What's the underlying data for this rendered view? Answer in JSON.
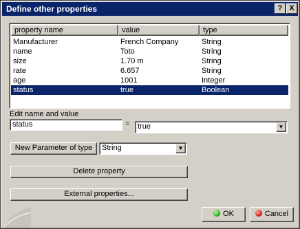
{
  "window": {
    "title": "Define other properties",
    "help_label": "?",
    "close_label": "X"
  },
  "list": {
    "columns": [
      "property name",
      "value",
      "type"
    ],
    "rows": [
      {
        "name": "Manufacturer",
        "value": "French Company",
        "type": "String"
      },
      {
        "name": "name",
        "value": "Toto",
        "type": "String"
      },
      {
        "name": "size",
        "value": "1.70 m",
        "type": "String"
      },
      {
        "name": "rate",
        "value": "6.657",
        "type": "String"
      },
      {
        "name": "age",
        "value": "1001",
        "type": "Integer"
      },
      {
        "name": "status",
        "value": "true",
        "type": "Boolean"
      }
    ],
    "selected_index": 5
  },
  "edit": {
    "label": "Edit name and value",
    "name_value": "status",
    "equals": "=",
    "value_selected": "true"
  },
  "new_param": {
    "button_label": "New Parameter of type",
    "type_selected": "String"
  },
  "buttons": {
    "delete": "Delete property",
    "external": "External properties...",
    "ok": "OK",
    "cancel": "Cancel"
  },
  "colors": {
    "title_bar": "#0a246a",
    "selection": "#0a246a",
    "face": "#d4d0c8"
  },
  "icons": {
    "ok": "green-dot-icon",
    "cancel": "red-dot-icon",
    "dropdown": "chevron-down-icon"
  }
}
